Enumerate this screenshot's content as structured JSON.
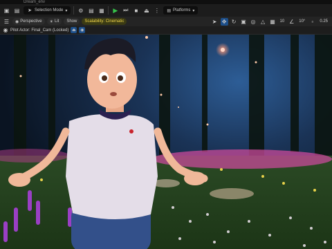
{
  "titlebar": {
    "title": "Dream_env"
  },
  "toolbar": {
    "selection_mode": "Selection Mode",
    "platforms": "Platforms"
  },
  "viewport_toolbar": {
    "perspective": "Perspective",
    "lit": "Lit",
    "show": "Show",
    "scalability": "Scalability: Cinematic",
    "grid_snap": "10",
    "rotation_snap": "10°",
    "scale_snap": "0.25"
  },
  "pilot": {
    "label": "Pilot Actor: Final_Cam (Locked)"
  },
  "colors": {
    "accent": "#1d4f8a",
    "play": "#36c24a",
    "scalability": "#f2d64b"
  },
  "icons": [
    "menu-icon",
    "save-icon",
    "content-icon",
    "blueprint-icon",
    "sequence-icon",
    "play-icon",
    "step-icon",
    "stop-icon",
    "eject-icon",
    "more-icon",
    "select-icon",
    "move-icon",
    "rotate-icon",
    "scale-icon",
    "world-icon",
    "grid-icon",
    "angle-icon",
    "scale-snap-icon",
    "camera-speed-icon",
    "layout-icon",
    "eject-pilot-icon",
    "camera-icon"
  ]
}
